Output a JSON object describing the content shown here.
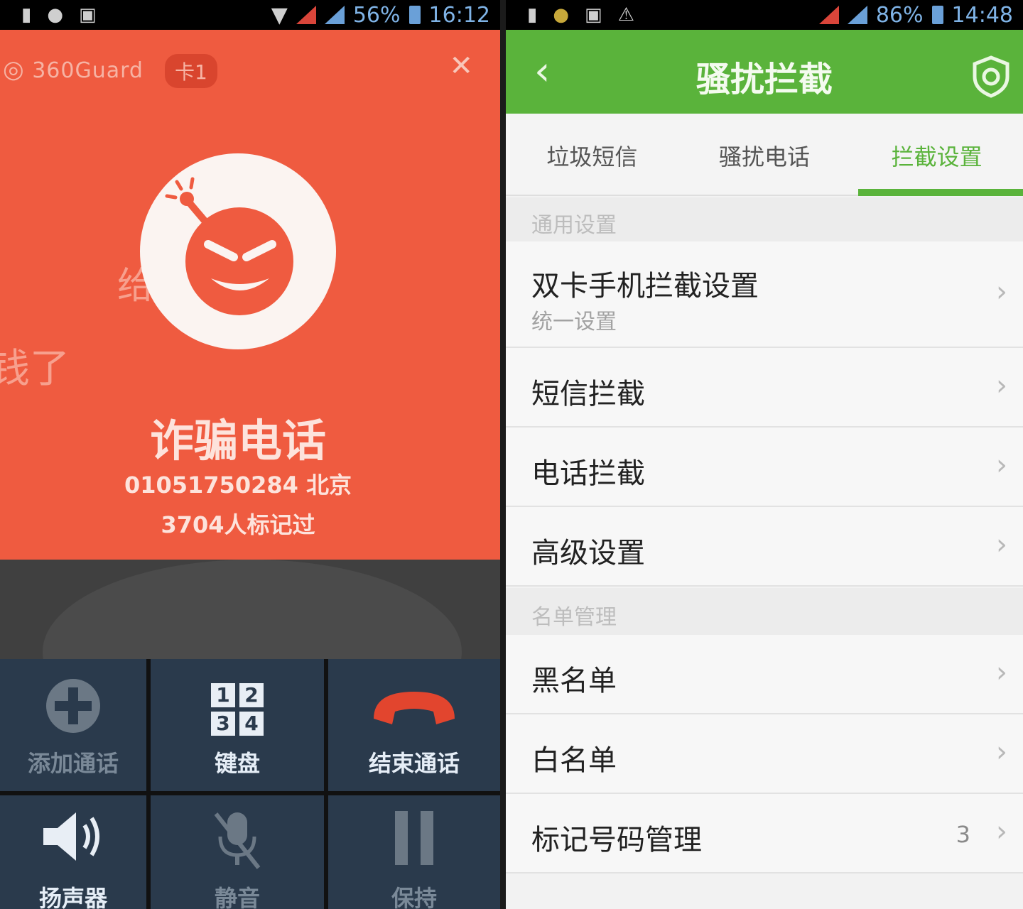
{
  "left_screen": {
    "status_bar": {
      "battery": "56%",
      "time": "16:12"
    },
    "header": {
      "brand": "360Guard",
      "sim_label": "卡1"
    },
    "background_text": [
      "给",
      "钱了"
    ],
    "caller": {
      "type": "诈骗电话",
      "number": "01051750284 北京",
      "marked": "3704人标记过"
    },
    "buttons": [
      {
        "label": "添加通话",
        "icon": "add-call-icon"
      },
      {
        "label": "键盘",
        "icon": "keypad-icon",
        "keys": [
          "1",
          "2",
          "3",
          "4"
        ]
      },
      {
        "label": "结束通话",
        "icon": "end-call-icon"
      },
      {
        "label": "扬声器",
        "icon": "speaker-icon"
      },
      {
        "label": "静音",
        "icon": "mute-icon"
      },
      {
        "label": "保持",
        "icon": "hold-icon"
      }
    ],
    "colors": {
      "alert_bg": "#ef5b40",
      "button_bg": "#2a3a4c",
      "end_call": "#e2452e"
    }
  },
  "right_screen": {
    "status_bar": {
      "battery": "86%",
      "time": "14:48"
    },
    "app_bar": {
      "title": "骚扰拦截"
    },
    "tabs": [
      "垃圾短信",
      "骚扰电话",
      "拦截设置"
    ],
    "active_tab": "拦截设置",
    "sections": [
      {
        "header": "通用设置",
        "items": [
          {
            "label": "双卡手机拦截设置",
            "sub": "统一设置"
          },
          {
            "label": "短信拦截"
          },
          {
            "label": "电话拦截"
          },
          {
            "label": "高级设置"
          }
        ]
      },
      {
        "header": "名单管理",
        "items": [
          {
            "label": "黑名单"
          },
          {
            "label": "白名单"
          },
          {
            "label": "标记号码管理",
            "count": "3"
          }
        ]
      }
    ],
    "colors": {
      "accent": "#5ab33b"
    }
  }
}
